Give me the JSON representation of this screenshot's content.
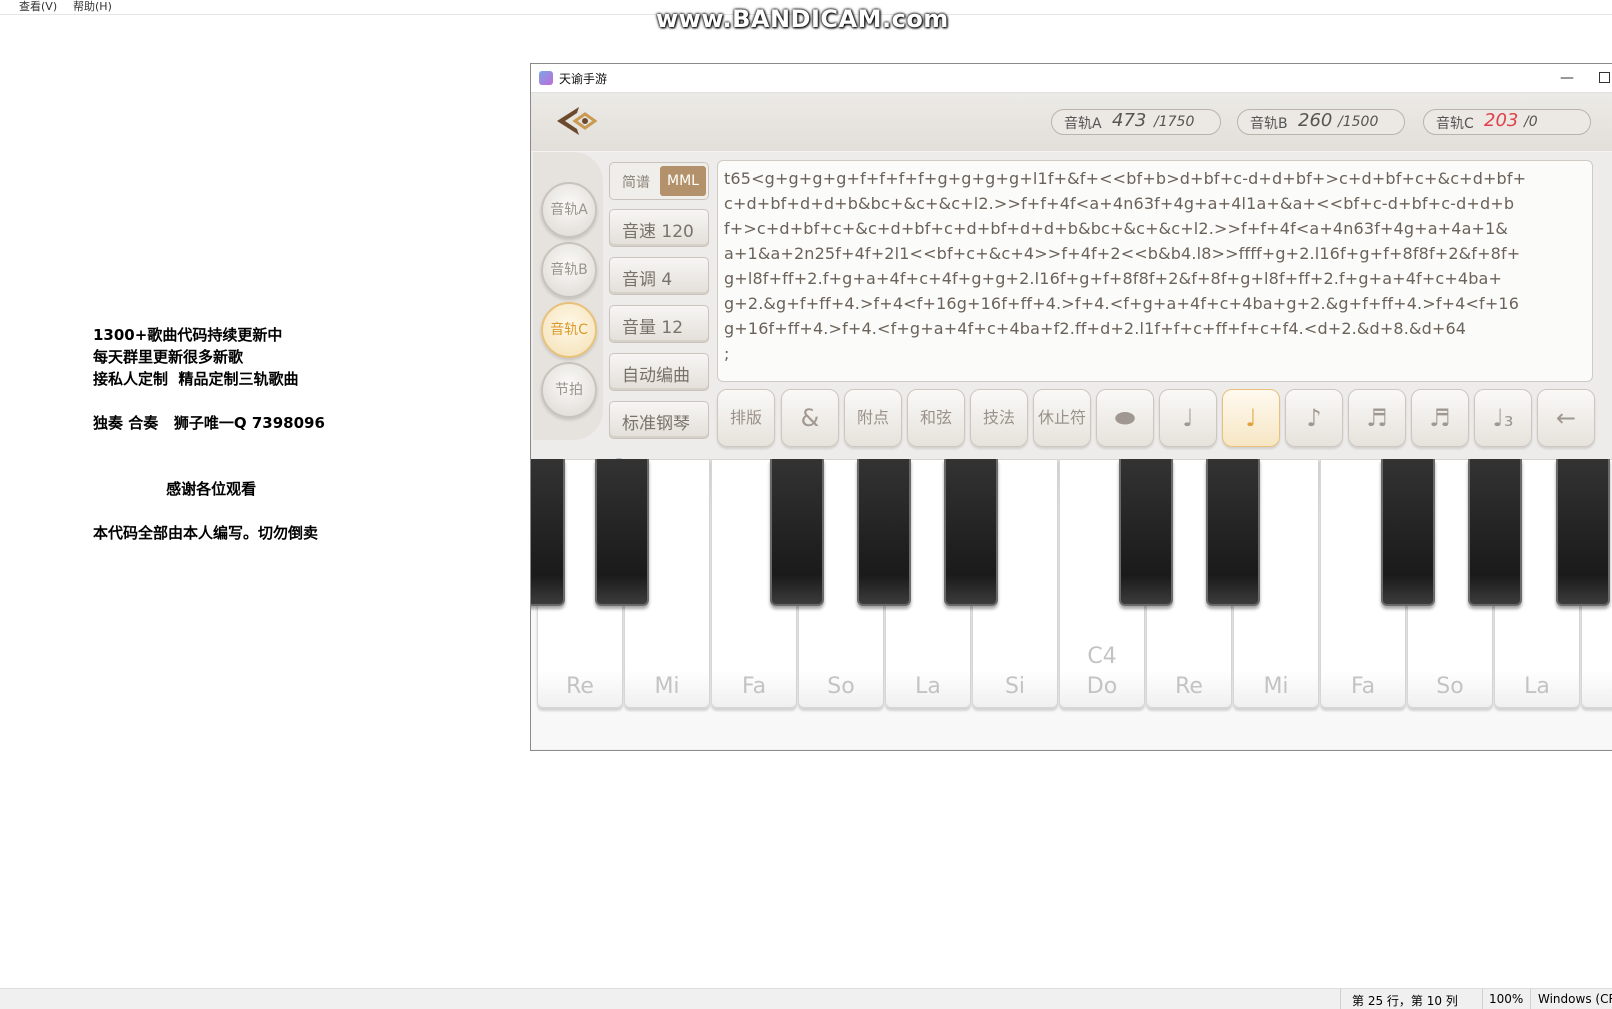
{
  "notepad": {
    "menu": [
      "查看(V)",
      "帮助(H)"
    ],
    "lines": [
      "1300+歌曲代码持续更新中",
      "每天群里更新很多新歌",
      "接私人定制  精品定制三轨歌曲",
      "",
      "独奏 合奏   狮子唯一Q 7398096",
      "",
      "",
      "              感谢各位观看",
      "",
      "本代码全部由本人编写。切勿倒卖"
    ],
    "status": {
      "position": "第 25 行，第 10 列",
      "zoom": "100%",
      "encoding": "Windows (CR"
    }
  },
  "watermark": "www.BANDICAM.com",
  "game": {
    "title": "天谕手游",
    "tracks": [
      {
        "label": "音轨A",
        "used": "473",
        "max": "/1750"
      },
      {
        "label": "音轨B",
        "used": "260",
        "max": "/1500"
      },
      {
        "label": "音轨C",
        "used": "203",
        "max": "/0",
        "over": true
      }
    ],
    "side_buttons": [
      "音轨A",
      "音轨B",
      "音轨C",
      "节拍"
    ],
    "active_side": "音轨C",
    "mode": {
      "jianpu": "简谱",
      "mml": "MML"
    },
    "controls": [
      "音速 120",
      "音调 4",
      "音量 12",
      "自动编曲",
      "标准钢琴"
    ],
    "code_lines": [
      "t65<g+g+g+g+f+f+f+f+g+g+g+g+l1f+&f+<<bf+b>d+bf+c-d+d+bf+>c+d+bf+c+&c+d+bf+",
      "c+d+bf+d+d+b&bc+&c+&c+l2.>>f+f+4f<a+4n63f+4g+a+4l1a+&a+<<bf+c-d+bf+c-d+d+b",
      "f+>c+d+bf+c+&c+d+bf+c+d+bf+d+d+b&bc+&c+&c+l2.>>f+f+4f<a+4n63f+4g+a+4a+1&",
      "a+1&a+2n25f+4f+2l1<<bf+c+&c+4>>f+4f+2<<b&b4.l8>>ffff+g+2.l16f+g+f+8f8f+2&f+8f+",
      "g+l8f+ff+2.f+g+a+4f+c+4f+g+g+2.l16f+g+f+8f8f+2&f+8f+g+l8f+ff+2.f+g+a+4f+c+4ba+",
      "g+2.&g+f+ff+4.>f+4<f+16g+16f+ff+4.>f+4.<f+g+a+4f+c+4ba+g+2.&g+f+ff+4.>f+4<f+16",
      "g+16f+ff+4.>f+4.<f+g+a+4f+c+4ba+f2.ff+d+2.l1f+f+c+ff+f+c+f4.<d+2.&d+8.&d+64",
      ";"
    ],
    "tools": [
      "排版",
      "&",
      "附点",
      "和弦",
      "技法",
      "休止符"
    ],
    "note_buttons": [
      {
        "name": "whole-note-icon",
        "glyph": "⬬"
      },
      {
        "name": "half-note-icon",
        "glyph": "♩"
      },
      {
        "name": "quarter-note-icon",
        "glyph": "♩"
      },
      {
        "name": "eighth-note-icon",
        "glyph": "♪"
      },
      {
        "name": "sixteenth-note-icon",
        "glyph": "♬"
      },
      {
        "name": "thirtysecond-note-icon",
        "glyph": "♬"
      },
      {
        "name": "triplet-note-icon",
        "glyph": "♩₃"
      },
      {
        "name": "backspace-icon",
        "glyph": "←"
      }
    ],
    "selected_note": "quarter-note-icon",
    "piano_keys": [
      "Re",
      "Mi",
      "Fa",
      "So",
      "La",
      "Si",
      "Do",
      "Re",
      "Mi",
      "Fa",
      "So",
      "La"
    ],
    "c4_label": "C4",
    "colors": {
      "accent": "#e0a23a",
      "over_limit": "#e0404a",
      "mml_bg": "#b3916a"
    }
  }
}
